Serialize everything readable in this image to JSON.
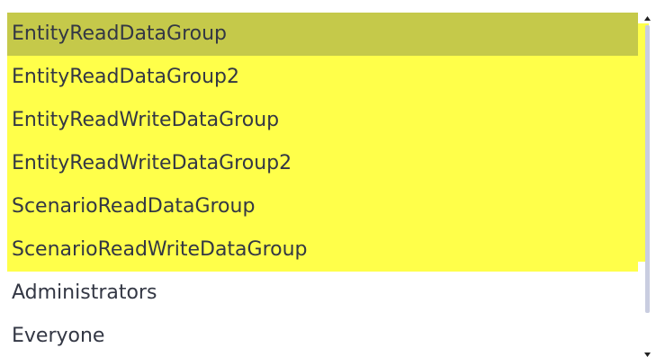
{
  "listbox": {
    "items": [
      {
        "label": "EntityReadDataGroup",
        "state": "selected"
      },
      {
        "label": "EntityReadDataGroup2",
        "state": "highlighted"
      },
      {
        "label": "EntityReadWriteDataGroup",
        "state": "highlighted"
      },
      {
        "label": "EntityReadWriteDataGroup2",
        "state": "highlighted"
      },
      {
        "label": "ScenarioReadDataGroup",
        "state": "highlighted"
      },
      {
        "label": "ScenarioReadWriteDataGroup",
        "state": "highlighted"
      },
      {
        "label": "Administrators",
        "state": "normal"
      },
      {
        "label": "Everyone",
        "state": "normal"
      }
    ]
  },
  "scrollbar": {
    "up_icon": "triangle-up-icon",
    "down_icon": "triangle-down-icon"
  },
  "colors": {
    "highlight": "#ffff4a",
    "selected": "#c5c94a",
    "text": "#333744",
    "scroll_thumb": "#c9cde0"
  }
}
